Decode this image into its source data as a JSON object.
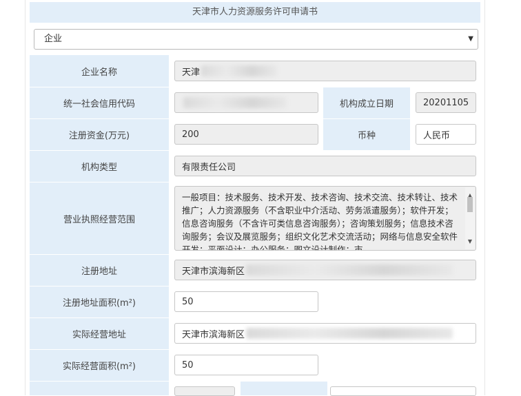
{
  "form": {
    "title": "天津市人力资源服务许可申请书",
    "entity_type": "企业"
  },
  "fields": {
    "company_name_label": "企业名称",
    "company_name_value": "天津",
    "credit_code_label": "统一社会信用代码",
    "credit_code_value": "",
    "founded_label": "机构成立日期",
    "founded_value": "20201105",
    "capital_label": "注册资金(万元)",
    "capital_value": "200",
    "currency_label": "币种",
    "currency_value": "人民币",
    "org_type_label": "机构类型",
    "org_type_value": "有限责任公司",
    "scope_label": "营业执照经营范围",
    "scope_value": "一般项目：技术服务、技术开发、技术咨询、技术交流、技术转让、技术推广；人力资源服务（不含职业中介活动、劳务派遣服务）；软件开发；信息咨询服务（不含许可类信息咨询服务）；咨询策划服务；信息技术咨询服务；会议及展览服务；组织文化艺术交流活动；网络与信息安全软件开发；平面设计；办公服务；图文设计制作；市",
    "reg_address_label": "注册地址",
    "reg_address_value": "天津市滨海新区",
    "reg_area_label": "注册地址面积(m²)",
    "reg_area_value": "50",
    "actual_address_label": "实际经营地址",
    "actual_address_value": "天津市滨海新区",
    "actual_area_label": "实际经营面积(m²)",
    "actual_area_value": "50"
  }
}
